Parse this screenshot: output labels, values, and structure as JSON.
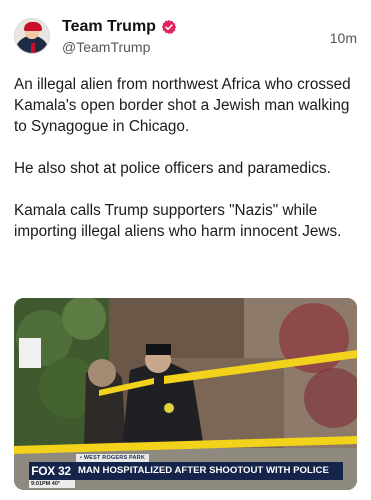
{
  "author": {
    "display_name": "Team Trump",
    "handle": "@TeamTrump",
    "verified": true
  },
  "post": {
    "timestamp": "10m",
    "paragraphs": [
      "An illegal alien from northwest Africa who crossed Kamala's open border shot a Jewish man walking to Synagogue in Chicago.",
      "He also shot at police officers and paramedics.",
      "Kamala calls Trump supporters \"Nazis\" while importing illegal aliens who harm innocent Jews."
    ]
  },
  "media": {
    "channel_logo": "FOX 32",
    "location_tag": "• WEST ROGERS PARK",
    "headline": "MAN HOSPITALIZED AFTER SHOOTOUT WITH POLICE",
    "clock": "9:01PM  40°"
  },
  "colors": {
    "verified_badge": "#e0245e",
    "chyron_bg": "#15244a",
    "caution_tape": "#f2d21b"
  },
  "icons": {
    "verified": "verified-badge-icon"
  }
}
